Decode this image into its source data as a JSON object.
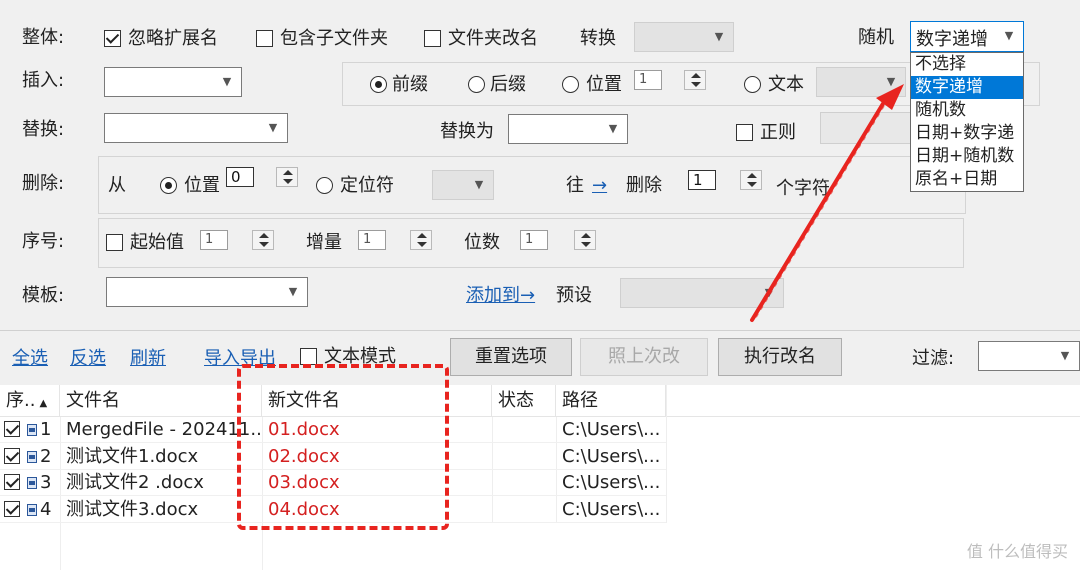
{
  "rows": {
    "whole": {
      "label": "整体:",
      "ignore_ext": "忽略扩展名",
      "include_subfolders": "包含子文件夹",
      "folder_rename": "文件夹改名",
      "convert": "转换",
      "random": "随机",
      "random_value": "数字递增"
    },
    "insert": {
      "label": "插入:",
      "prefix": "前缀",
      "suffix": "后缀",
      "position": "位置",
      "position_value": "1",
      "text": "文本"
    },
    "replace": {
      "label": "替换:",
      "replace_with": "替换为",
      "regex": "正则"
    },
    "delete": {
      "label": "删除:",
      "from": "从",
      "position": "位置",
      "position_value": "0",
      "delimiter": "定位符",
      "toward": "往",
      "arrow": "→",
      "delete": "删除",
      "count_value": "1",
      "chars": "个字符"
    },
    "seq": {
      "label": "序号:",
      "start": "起始值",
      "start_value": "1",
      "increment": "增量",
      "increment_value": "1",
      "digits": "位数",
      "digits_value": "1"
    },
    "template": {
      "label": "模板:",
      "add_to": "添加到→",
      "preset": "预设"
    }
  },
  "dropdown": {
    "options": [
      "不选择",
      "数字递增",
      "随机数",
      "日期+数字递",
      "日期+随机数",
      "原名+日期"
    ],
    "selected_index": 1
  },
  "toolbar": {
    "select_all": "全选",
    "invert": "反选",
    "refresh": "刷新",
    "import_export": "导入导出",
    "text_mode": "文本模式",
    "reset": "重置选项",
    "same_as_last": "照上次改",
    "execute": "执行改名",
    "filter": "过滤:"
  },
  "table": {
    "headers": [
      "序..",
      "文件名",
      "新文件名",
      "状态",
      "路径"
    ],
    "rows": [
      {
        "num": "1",
        "name": "MergedFile - 202411...",
        "new_name": "01.docx",
        "status": "",
        "path": "C:\\Users\\..."
      },
      {
        "num": "2",
        "name": "测试文件1.docx",
        "new_name": "02.docx",
        "status": "",
        "path": "C:\\Users\\..."
      },
      {
        "num": "3",
        "name": "测试文件2 .docx",
        "new_name": "03.docx",
        "status": "",
        "path": "C:\\Users\\..."
      },
      {
        "num": "4",
        "name": "测试文件3.docx",
        "new_name": "04.docx",
        "status": "",
        "path": "C:\\Users\\..."
      }
    ]
  },
  "watermark": "值 什么值得买",
  "colors": {
    "accent": "#0078d7",
    "link": "#1a5fb4",
    "new_name": "#d42020",
    "annotation": "#e8241f"
  }
}
